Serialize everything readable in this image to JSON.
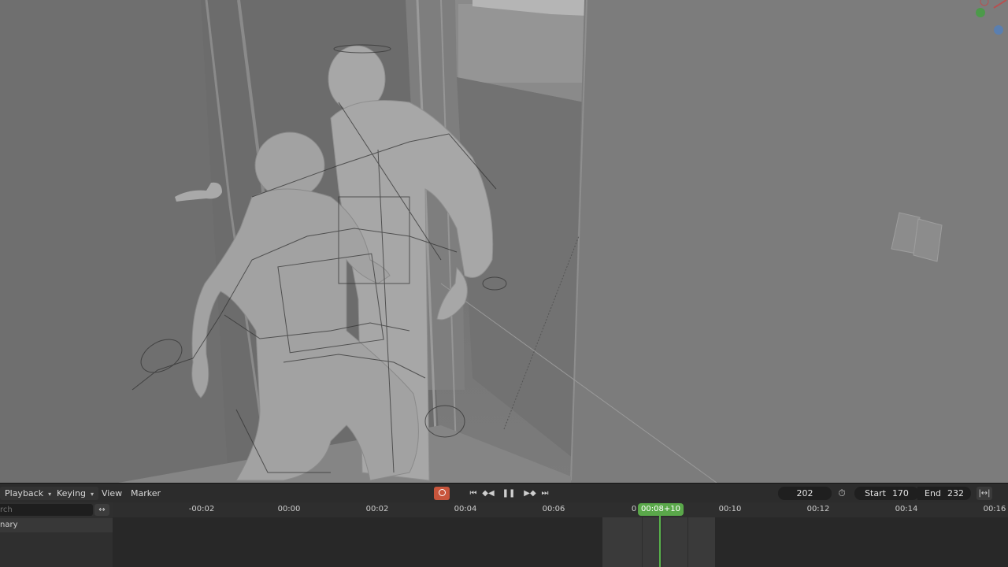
{
  "header": {
    "playback_label": "Playback",
    "keying_label": "Keying",
    "view_label": "View",
    "marker_label": "Marker",
    "current_frame": "202",
    "start_label": "Start",
    "start_value": "170",
    "end_label": "End",
    "end_value": "232"
  },
  "left_panel": {
    "search_placeholder": "rch",
    "channel_label": "nary"
  },
  "ruler": {
    "ticks": [
      "-00:02",
      "00:00",
      "00:02",
      "00:04",
      "00:06",
      "0",
      "00:10",
      "00:12",
      "00:14",
      "00:16"
    ],
    "current_time": "00:08+10"
  },
  "colors": {
    "accent_green": "#5aa84a",
    "record_red": "#c8553c",
    "viewport_gray": "#7a7a7a"
  },
  "icons": [
    "record-icon",
    "jump-start-icon",
    "prev-keyframe-icon",
    "play-pause-icon",
    "next-keyframe-icon",
    "jump-end-icon",
    "stopwatch-icon",
    "sync-icon",
    "navigation-gizmo-icon"
  ]
}
